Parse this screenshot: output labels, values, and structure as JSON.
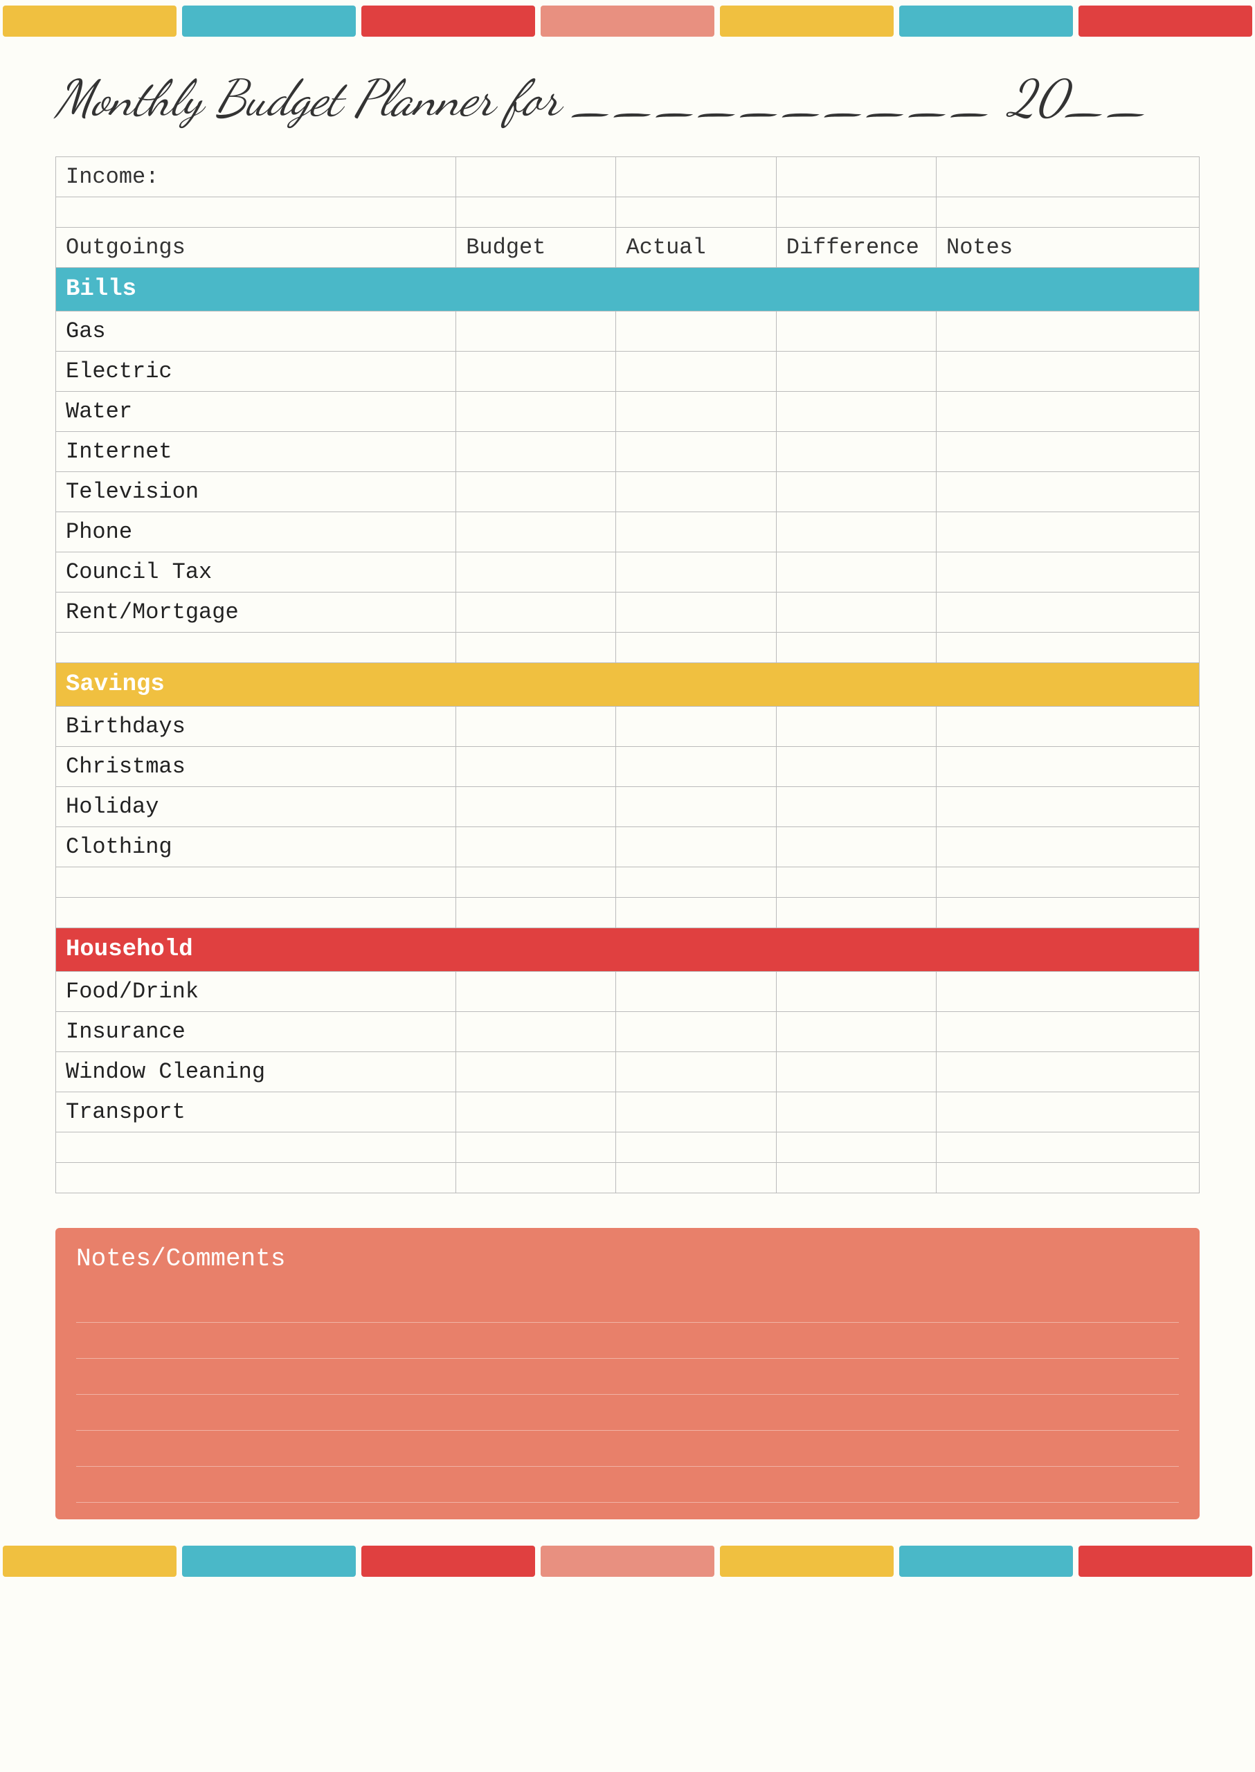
{
  "topBar": {
    "segments": [
      "yellow",
      "teal",
      "red",
      "salmon",
      "yellow2",
      "teal2",
      "red2"
    ]
  },
  "title": {
    "line1": "Monthly Budget Planner for __________ 20__"
  },
  "table": {
    "incomeLabel": "Income:",
    "headers": {
      "outgoings": "Outgoings",
      "budget": "Budget",
      "actual": "Actual",
      "difference": "Difference",
      "notes": "Notes"
    },
    "sections": {
      "bills": {
        "label": "Bills",
        "rows": [
          "Gas",
          "Electric",
          "Water",
          "Internet",
          "Television",
          "Phone",
          "Council Tax",
          "Rent/Mortgage"
        ]
      },
      "savings": {
        "label": "Savings",
        "rows": [
          "Birthdays",
          "Christmas",
          "Holiday",
          "Clothing"
        ]
      },
      "household": {
        "label": "Household",
        "rows": [
          "Food/Drink",
          "Insurance",
          "Window Cleaning",
          "Transport"
        ]
      }
    }
  },
  "notes": {
    "title": "Notes/Comments"
  },
  "colors": {
    "yellow": "#f0c040",
    "teal": "#4ab8c8",
    "red": "#e04040",
    "salmon": "#e89080",
    "notesBackground": "#e8806a"
  }
}
